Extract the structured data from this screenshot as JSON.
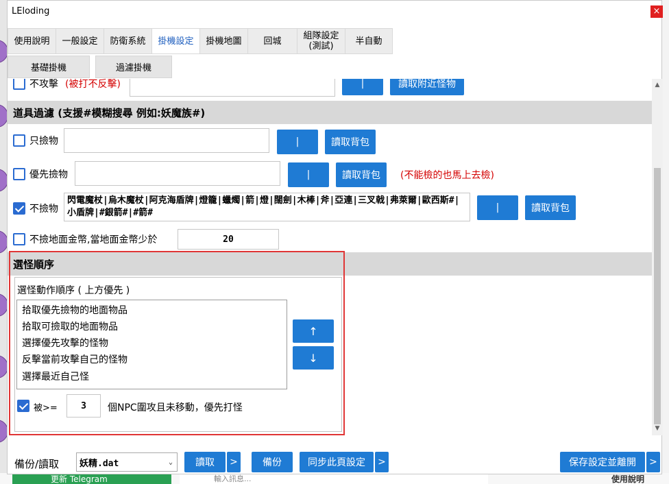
{
  "window": {
    "title": "LEloding",
    "close": "×"
  },
  "tabs": [
    {
      "label": "使用說明"
    },
    {
      "label": "一般設定"
    },
    {
      "label": "防衛系統"
    },
    {
      "label": "掛機設定"
    },
    {
      "label": "掛機地圖"
    },
    {
      "label": "回城"
    },
    {
      "label": "組隊設定\n(測試)"
    },
    {
      "label": "半自動"
    }
  ],
  "subtabs": [
    {
      "label": "基礎掛機"
    },
    {
      "label": "過濾掛機"
    }
  ],
  "partial_row": {
    "label": "不攻擊",
    "note": "(被打不反擊)",
    "bar_btn": "|",
    "read_btn": "讀取附近怪物"
  },
  "item_filter": {
    "header": "道具過濾 (支援#模糊搜尋 例如:妖魔族#)",
    "only_pick": {
      "label": "只撿物",
      "value": "",
      "bar_btn": "|",
      "read_btn": "讀取背包"
    },
    "priority_pick": {
      "label": "優先撿物",
      "value": "",
      "bar_btn": "|",
      "read_btn": "讀取背包",
      "note": "(不能檢的也馬上去檢)"
    },
    "no_pick": {
      "label": "不撿物",
      "value": "閃電魔杖|烏木魔杖|阿克海盾牌|燈籠|蠟燭|箭|燈|闊劍|木棒|斧|亞連|三叉戟|弗萊爾|歐西斯#|小盾牌|#銀箭#|#箭#",
      "bar_btn": "|",
      "read_btn": "讀取背包"
    },
    "no_gold": {
      "label": "不撿地面金幣,當地面金幣少於",
      "value": "20"
    }
  },
  "monster_order": {
    "header": "選怪順序",
    "group_title": "選怪動作順序 ( 上方優先 )",
    "items": [
      "拾取優先撿物的地面物品",
      "拾取可撿取的地面物品",
      "選擇優先攻擊的怪物",
      "反擊當前攻擊自己的怪物",
      "選擇最近自己怪"
    ],
    "up": "↑",
    "down": "↓",
    "surround": {
      "label": "被>=",
      "value": "3",
      "suffix": "個NPC圍攻且未移動，優先打怪"
    }
  },
  "bottom": {
    "backup_label": "備份/讀取",
    "file": "妖精.dat",
    "read_btn": "讀取",
    "more": ">",
    "backup_btn": "備份",
    "sync_btn": "同步此頁設定",
    "save_btn": "保存設定並離開"
  },
  "background": {
    "telegram": "更新 Telegram",
    "search": "輸入訊息...",
    "help": "使用說明"
  }
}
